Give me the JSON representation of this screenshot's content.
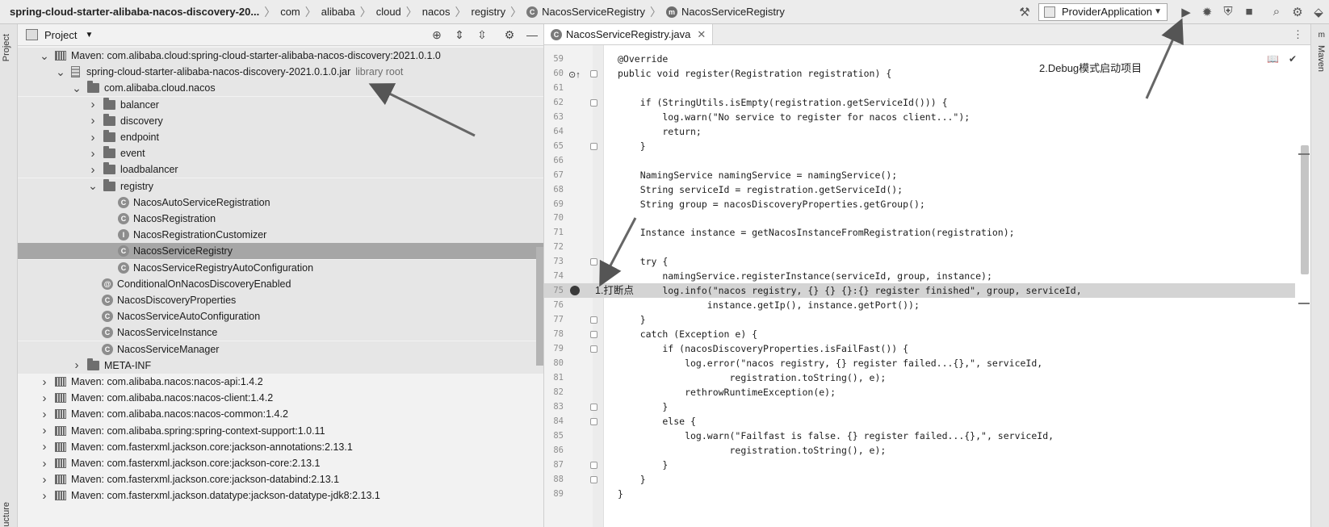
{
  "breadcrumb": {
    "items": [
      "spring-cloud-starter-alibaba-nacos-discovery-20...",
      "com",
      "alibaba",
      "cloud",
      "nacos",
      "registry",
      "NacosServiceRegistry",
      "NacosServiceRegistry"
    ]
  },
  "toolbar": {
    "run_config": "ProviderApplication",
    "icons": [
      "hammer-icon",
      "run-icon",
      "debug-icon",
      "coverage-icon",
      "stop-icon",
      "search-icon",
      "gear-icon",
      "plugin-icon"
    ]
  },
  "left_strip": {
    "project_tab": "Project",
    "structure_tab": "ucture"
  },
  "right_strip": {
    "maven_tab": "Maven"
  },
  "project": {
    "title": "Project",
    "tree": [
      {
        "label": "Maven: com.alibaba.cloud:spring-cloud-starter-alibaba-nacos-discovery:2021.0.1.0",
        "icon": "library",
        "arrow": "down"
      },
      {
        "label": "spring-cloud-starter-alibaba-nacos-discovery-2021.0.1.0.jar",
        "icon": "jar",
        "arrow": "down",
        "suffix": "library root"
      },
      {
        "label": "com.alibaba.cloud.nacos",
        "icon": "folder",
        "arrow": "down"
      },
      {
        "label": "balancer",
        "icon": "folder",
        "arrow": "right"
      },
      {
        "label": "discovery",
        "icon": "folder",
        "arrow": "right"
      },
      {
        "label": "endpoint",
        "icon": "folder",
        "arrow": "right"
      },
      {
        "label": "event",
        "icon": "folder",
        "arrow": "right"
      },
      {
        "label": "loadbalancer",
        "icon": "folder",
        "arrow": "right"
      },
      {
        "label": "registry",
        "icon": "folder",
        "arrow": "down"
      },
      {
        "label": "NacosAutoServiceRegistration",
        "icon": "class",
        "letter": "C"
      },
      {
        "label": "NacosRegistration",
        "icon": "class",
        "letter": "C"
      },
      {
        "label": "NacosRegistrationCustomizer",
        "icon": "class",
        "letter": "I"
      },
      {
        "label": "NacosServiceRegistry",
        "icon": "class",
        "letter": "C"
      },
      {
        "label": "NacosServiceRegistryAutoConfiguration",
        "icon": "class",
        "letter": "C"
      },
      {
        "label": "ConditionalOnNacosDiscoveryEnabled",
        "icon": "class",
        "letter": "@"
      },
      {
        "label": "NacosDiscoveryProperties",
        "icon": "class",
        "letter": "C"
      },
      {
        "label": "NacosServiceAutoConfiguration",
        "icon": "class",
        "letter": "C"
      },
      {
        "label": "NacosServiceInstance",
        "icon": "class",
        "letter": "C"
      },
      {
        "label": "NacosServiceManager",
        "icon": "class",
        "letter": "C"
      },
      {
        "label": "META-INF",
        "icon": "folder",
        "arrow": "right"
      },
      {
        "label": "Maven: com.alibaba.nacos:nacos-api:1.4.2",
        "icon": "library",
        "arrow": "right"
      },
      {
        "label": "Maven: com.alibaba.nacos:nacos-client:1.4.2",
        "icon": "library",
        "arrow": "right"
      },
      {
        "label": "Maven: com.alibaba.nacos:nacos-common:1.4.2",
        "icon": "library",
        "arrow": "right"
      },
      {
        "label": "Maven: com.alibaba.spring:spring-context-support:1.0.11",
        "icon": "library",
        "arrow": "right"
      },
      {
        "label": "Maven: com.fasterxml.jackson.core:jackson-annotations:2.13.1",
        "icon": "library",
        "arrow": "right"
      },
      {
        "label": "Maven: com.fasterxml.jackson.core:jackson-core:2.13.1",
        "icon": "library",
        "arrow": "right"
      },
      {
        "label": "Maven: com.fasterxml.jackson.core:jackson-databind:2.13.1",
        "icon": "library",
        "arrow": "right"
      },
      {
        "label": "Maven: com.fasterxml.jackson.datatype:jackson-datatype-jdk8:2.13.1",
        "icon": "library",
        "arrow": "right"
      }
    ]
  },
  "editor": {
    "tab_label": "NacosServiceRegistry.java",
    "breakpoint_label": "1.打断点",
    "debug_label": "2.Debug模式启动项目",
    "lines": [
      {
        "n": "59",
        "t": "@Override"
      },
      {
        "n": "60",
        "t": "public void register(Registration registration) {"
      },
      {
        "n": "61",
        "t": ""
      },
      {
        "n": "62",
        "t": "    if (StringUtils.isEmpty(registration.getServiceId())) {"
      },
      {
        "n": "63",
        "t": "        log.warn(\"No service to register for nacos client...\");"
      },
      {
        "n": "64",
        "t": "        return;"
      },
      {
        "n": "65",
        "t": "    }"
      },
      {
        "n": "66",
        "t": ""
      },
      {
        "n": "67",
        "t": "    NamingService namingService = namingService();"
      },
      {
        "n": "68",
        "t": "    String serviceId = registration.getServiceId();"
      },
      {
        "n": "69",
        "t": "    String group = nacosDiscoveryProperties.getGroup();"
      },
      {
        "n": "70",
        "t": ""
      },
      {
        "n": "71",
        "t": "    Instance instance = getNacosInstanceFromRegistration(registration);"
      },
      {
        "n": "72",
        "t": ""
      },
      {
        "n": "73",
        "t": "    try {"
      },
      {
        "n": "74",
        "t": "        namingService.registerInstance(serviceId, group, instance);"
      },
      {
        "n": "75",
        "t": "        log.info(\"nacos registry, {} {} {}:{} register finished\", group, serviceId,"
      },
      {
        "n": "76",
        "t": "                instance.getIp(), instance.getPort());"
      },
      {
        "n": "77",
        "t": "    }"
      },
      {
        "n": "78",
        "t": "    catch (Exception e) {"
      },
      {
        "n": "79",
        "t": "        if (nacosDiscoveryProperties.isFailFast()) {"
      },
      {
        "n": "80",
        "t": "            log.error(\"nacos registry, {} register failed...{},\", serviceId,"
      },
      {
        "n": "81",
        "t": "                    registration.toString(), e);"
      },
      {
        "n": "82",
        "t": "            rethrowRuntimeException(e);"
      },
      {
        "n": "83",
        "t": "        }"
      },
      {
        "n": "84",
        "t": "        else {"
      },
      {
        "n": "85",
        "t": "            log.warn(\"Failfast is false. {} register failed...{},\", serviceId,"
      },
      {
        "n": "86",
        "t": "                    registration.toString(), e);"
      },
      {
        "n": "87",
        "t": "        }"
      },
      {
        "n": "88",
        "t": "    }"
      },
      {
        "n": "89",
        "t": "}"
      }
    ]
  }
}
